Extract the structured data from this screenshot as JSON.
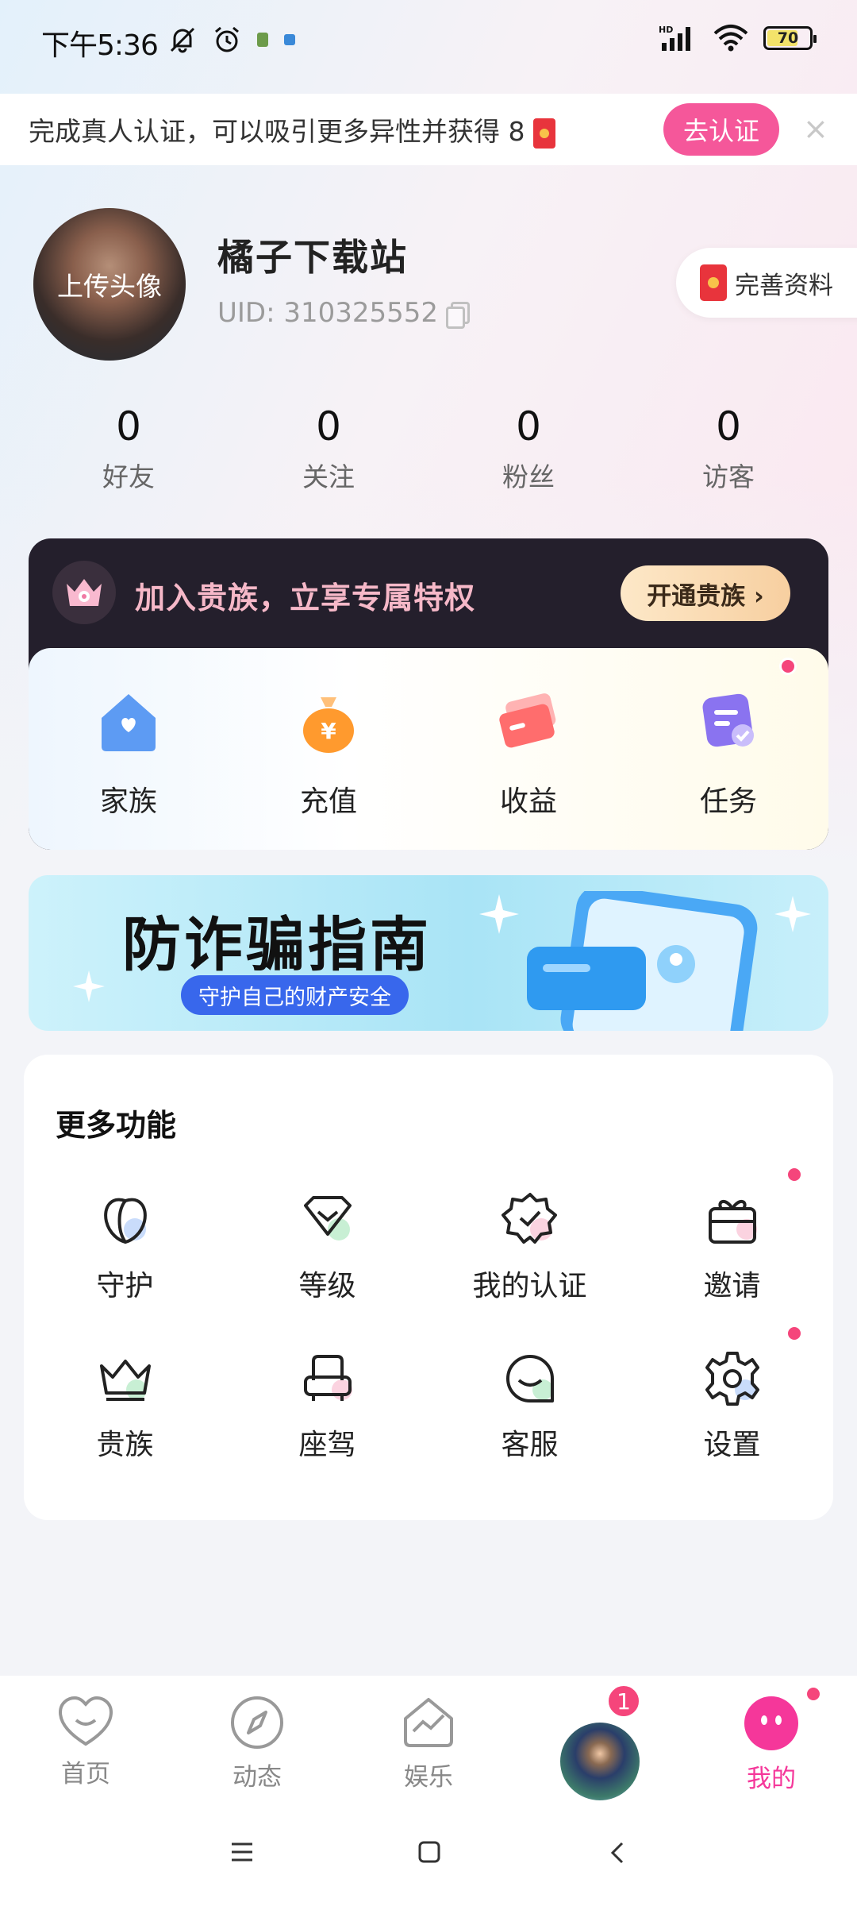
{
  "status_bar": {
    "time": "下午5:36",
    "battery": "70",
    "icons": [
      "mute-bell-icon",
      "alarm-icon",
      "hd-signal-icon",
      "wifi-icon"
    ]
  },
  "verify_banner": {
    "text": "完成真人认证，可以吸引更多异性并获得 8",
    "button": "去认证",
    "close": "×"
  },
  "profile": {
    "avatar_label": "上传头像",
    "username": "橘子下载站",
    "uid": "UID: 310325552",
    "complete_label": "完善资料"
  },
  "stats": [
    {
      "value": "0",
      "label": "好友"
    },
    {
      "value": "0",
      "label": "关注"
    },
    {
      "value": "0",
      "label": "粉丝"
    },
    {
      "value": "0",
      "label": "访客"
    }
  ],
  "noble": {
    "text": "加入贵族，立享专属特权",
    "button": "开通贵族"
  },
  "quick_actions": [
    {
      "label": "家族",
      "icon": "family-house-icon"
    },
    {
      "label": "充值",
      "icon": "recharge-bag-icon"
    },
    {
      "label": "收益",
      "icon": "earnings-card-icon"
    },
    {
      "label": "任务",
      "icon": "task-icon"
    }
  ],
  "fraud_banner": {
    "title": "防诈骗指南",
    "subtitle": "守护自己的财产安全"
  },
  "more": {
    "title": "更多功能",
    "items": [
      {
        "label": "守护",
        "icon": "guard-icon"
      },
      {
        "label": "等级",
        "icon": "level-icon"
      },
      {
        "label": "我的认证",
        "icon": "certification-icon"
      },
      {
        "label": "邀请",
        "icon": "invite-gift-icon"
      },
      {
        "label": "贵族",
        "icon": "crown-icon"
      },
      {
        "label": "座驾",
        "icon": "car-seat-icon"
      },
      {
        "label": "客服",
        "icon": "customer-service-icon"
      },
      {
        "label": "设置",
        "icon": "settings-gear-icon"
      }
    ]
  },
  "bottom_nav": {
    "items": [
      {
        "label": "首页",
        "icon": "home-heart-icon"
      },
      {
        "label": "动态",
        "icon": "compass-icon"
      },
      {
        "label": "娱乐",
        "icon": "entertainment-icon"
      },
      {
        "label": "",
        "icon": "live-avatar"
      },
      {
        "label": "我的",
        "icon": "profile-icon"
      }
    ],
    "avatar_badge": "1"
  },
  "colors": {
    "accent": "#f5579a",
    "noble_bg": "#241f2c",
    "active_tab": "#f5379a"
  }
}
